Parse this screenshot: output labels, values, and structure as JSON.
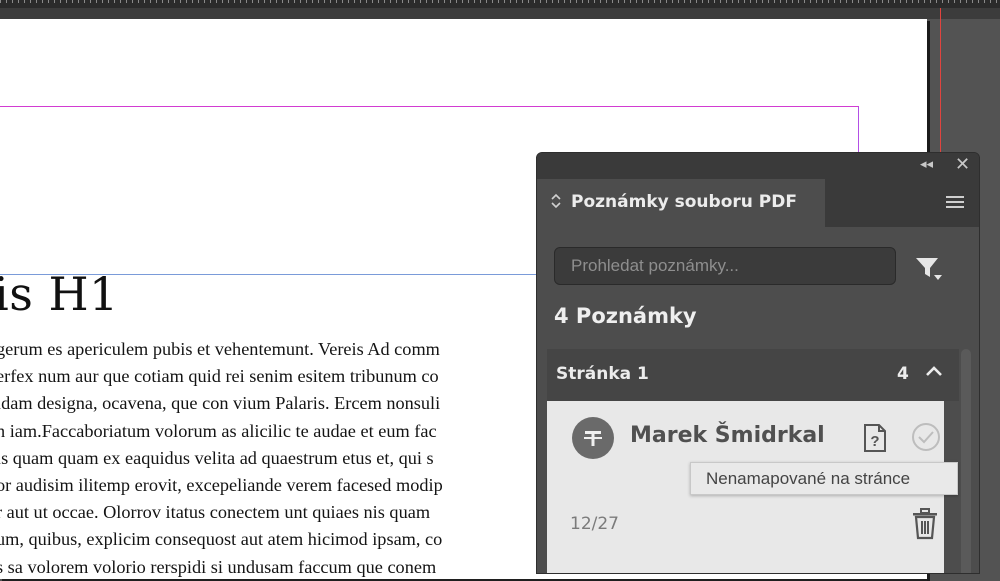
{
  "document": {
    "heading": "is H1",
    "lines": [
      "gerum es apericulem pubis et vehentemunt. Vereis Ad comm",
      "erfex num aur que cotiam quid rei senim esitem tribunum co",
      "idam designa, ocavena, que con vium Palaris. Ercem nonsuli",
      "n iam.Faccaboriatum volorum as alicilic te audae et eum fac",
      "is quam quam ex eaquidus velita ad quaestrum etus et, qui s",
      "or audisim ilitemp erovit, excepeliande verem facesed modip",
      "r aut ut occae. Olorrov itatus conectem unt quiaes nis quam",
      "um, quibus, explicim consequost aut atem hicimod ipsam, co",
      "s sa volorem volorio rerspidi si undusam faccum que conem"
    ]
  },
  "panel": {
    "collapse_glyph": "◂◂",
    "close_glyph": "✕",
    "tab_arrows": "⌃⌄",
    "tab_title": "Poznámky souboru PDF",
    "search_placeholder": "Prohledat poznámky...",
    "notes_count_label": "4 Poznámky",
    "group": {
      "title": "Stránka 1",
      "count": "4"
    },
    "note": {
      "author": "Marek Šmidrkal",
      "date": "12/27",
      "tooltip": "Nenamapované na stránce"
    },
    "icons": [
      "collapse-icon",
      "close-icon",
      "panel-menu-icon",
      "filter-icon",
      "chevron-up-icon",
      "text-annotation-icon",
      "unmapped-note-icon",
      "checkmark-icon",
      "trash-icon"
    ]
  },
  "colors": {
    "panel_bg": "#454545",
    "card_bg": "#e8e8e8",
    "margin_guide": "#d23bd2",
    "bleed_guide": "#e0443f",
    "frame_guide": "#7a9bd9"
  }
}
